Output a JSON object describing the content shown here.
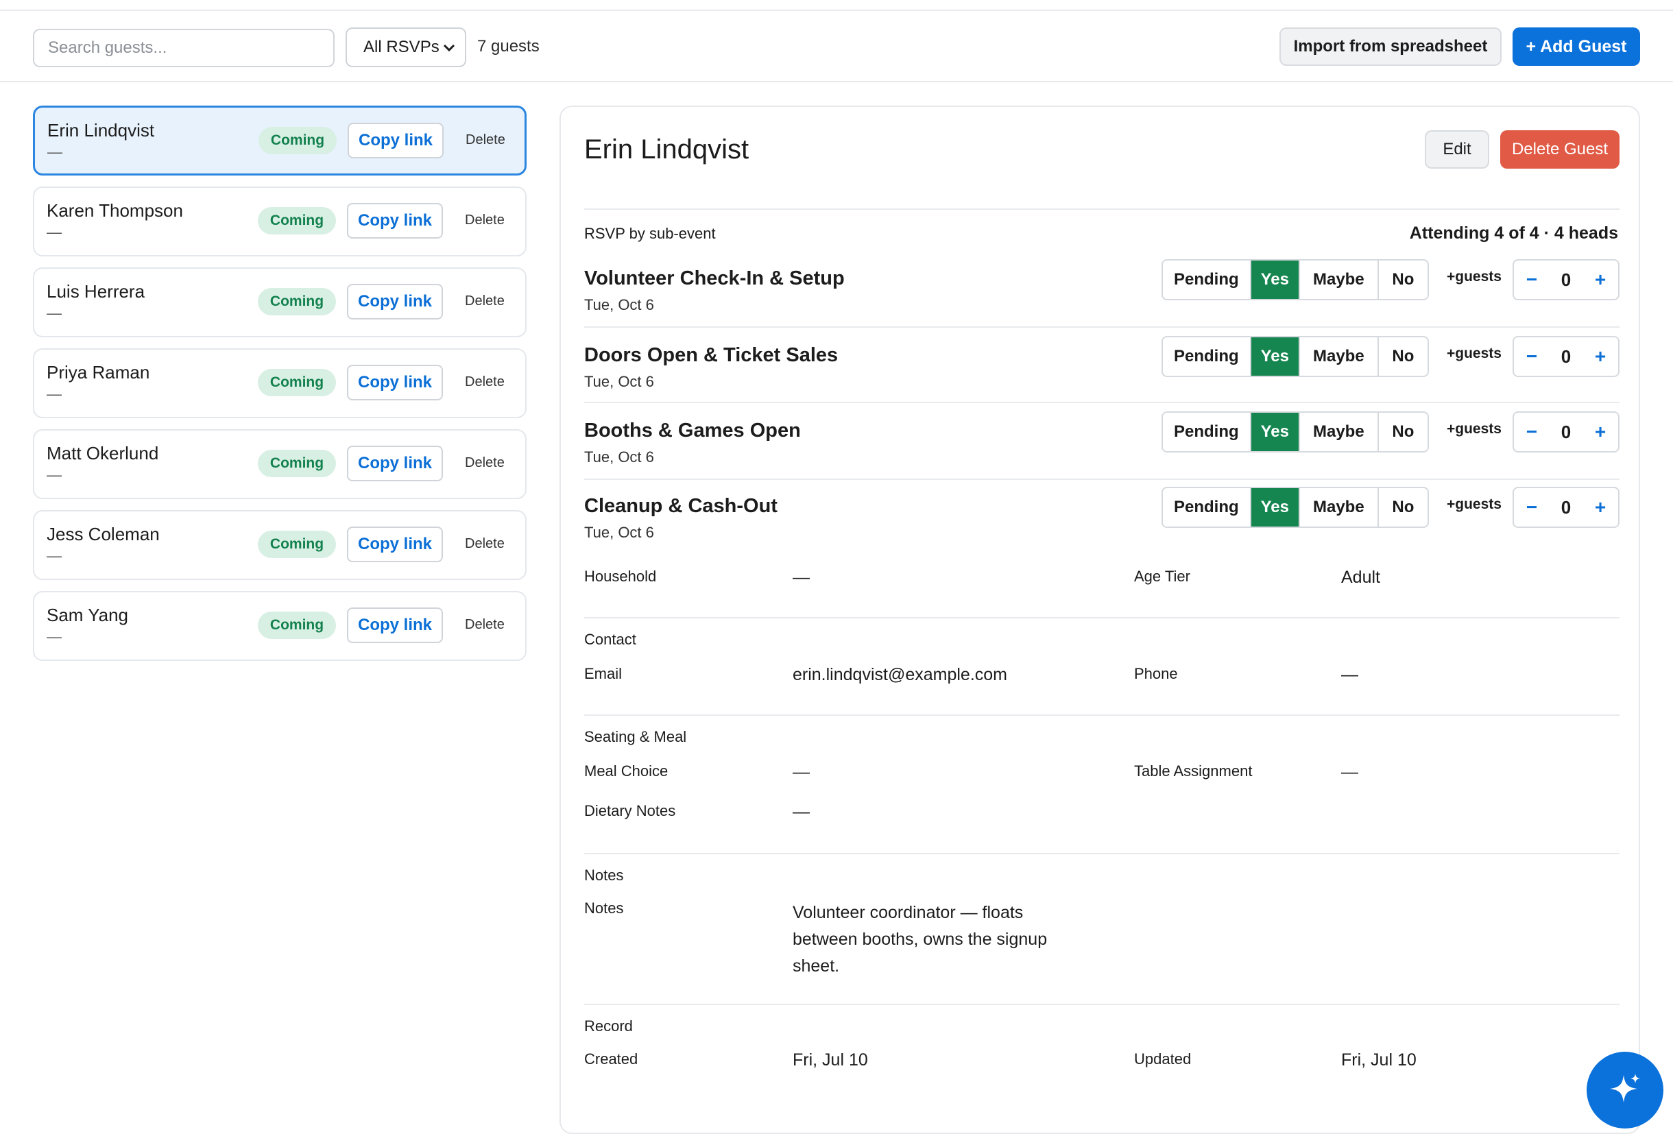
{
  "toolbar": {
    "search_placeholder": "Search guests...",
    "filter_value": "All RSVPs",
    "guest_count": "7 guests",
    "import_label": "Import from spreadsheet",
    "add_label": "+ Add Guest"
  },
  "guests": [
    {
      "name": "Erin Lindqvist",
      "sub": "—",
      "status": "Coming",
      "copy": "Copy link",
      "delete": "Delete"
    },
    {
      "name": "Karen Thompson",
      "sub": "—",
      "status": "Coming",
      "copy": "Copy link",
      "delete": "Delete"
    },
    {
      "name": "Luis Herrera",
      "sub": "—",
      "status": "Coming",
      "copy": "Copy link",
      "delete": "Delete"
    },
    {
      "name": "Priya Raman",
      "sub": "—",
      "status": "Coming",
      "copy": "Copy link",
      "delete": "Delete"
    },
    {
      "name": "Matt Okerlund",
      "sub": "—",
      "status": "Coming",
      "copy": "Copy link",
      "delete": "Delete"
    },
    {
      "name": "Jess Coleman",
      "sub": "—",
      "status": "Coming",
      "copy": "Copy link",
      "delete": "Delete"
    },
    {
      "name": "Sam Yang",
      "sub": "—",
      "status": "Coming",
      "copy": "Copy link",
      "delete": "Delete"
    }
  ],
  "detail": {
    "name": "Erin Lindqvist",
    "edit_label": "Edit",
    "delete_label": "Delete Guest",
    "rsvp_heading": "RSVP by sub-event",
    "attending": "Attending 4 of 4 · 4 heads",
    "rsvp_options": [
      "Pending",
      "Yes",
      "Maybe",
      "No"
    ],
    "plus_guests_label": "+guests",
    "events": [
      {
        "title": "Volunteer Check-In & Setup",
        "date": "Tue, Oct 6",
        "selected": "Yes",
        "extra": "0"
      },
      {
        "title": "Doors Open & Ticket Sales",
        "date": "Tue, Oct 6",
        "selected": "Yes",
        "extra": "0"
      },
      {
        "title": "Booths & Games Open",
        "date": "Tue, Oct 6",
        "selected": "Yes",
        "extra": "0"
      },
      {
        "title": "Cleanup & Cash-Out",
        "date": "Tue, Oct 6",
        "selected": "Yes",
        "extra": "0"
      }
    ],
    "household_label": "Household",
    "household_value": "—",
    "age_tier_label": "Age Tier",
    "age_tier_value": "Adult",
    "contact_heading": "Contact",
    "email_label": "Email",
    "email_value": "erin.lindqvist@example.com",
    "phone_label": "Phone",
    "phone_value": "—",
    "seating_heading": "Seating & Meal",
    "meal_label": "Meal Choice",
    "meal_value": "—",
    "table_label": "Table Assignment",
    "table_value": "—",
    "dietary_label": "Dietary Notes",
    "dietary_value": "—",
    "notes_heading": "Notes",
    "notes_label": "Notes",
    "notes_value": "Volunteer coordinator — floats between booths, owns the signup sheet.",
    "record_heading": "Record",
    "created_label": "Created",
    "created_value": "Fri, Jul 10",
    "updated_label": "Updated",
    "updated_value": "Fri, Jul 10"
  },
  "colors": {
    "accent": "#0b71db",
    "yes_green": "#15864f",
    "danger": "#e05a45",
    "badge_bg": "#d8efe4"
  },
  "icons": {
    "fab": "sparkle-icon",
    "select": "chevron-down-icon"
  }
}
